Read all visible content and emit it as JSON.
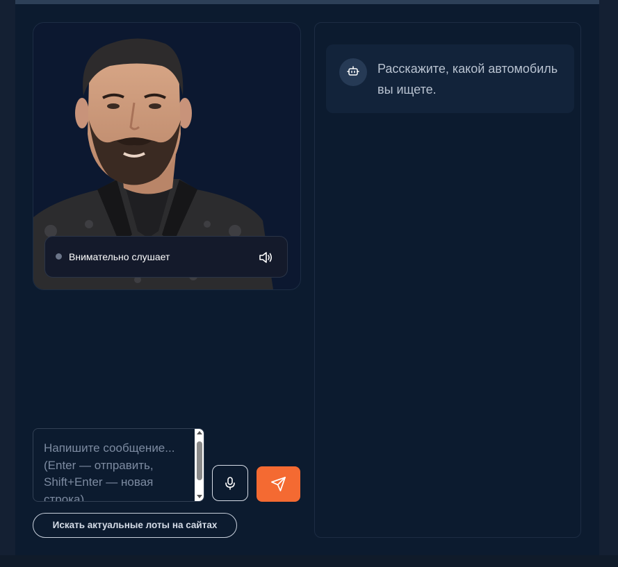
{
  "avatar": {
    "status_text": "Внимательно слушает",
    "icons": [
      "speaker-icon"
    ]
  },
  "composer": {
    "placeholder": "Напишите сообщение... (Enter — отправить, Shift+Enter — новая строка)",
    "mic_icon": "microphone-icon",
    "send_icon": "send-icon"
  },
  "search_lots_label": "Искать актуальные лоты на сайтах",
  "chat": {
    "bot_icon": "robot-icon",
    "message": "Расскажите, какой автомобиль вы ищете."
  },
  "colors": {
    "background": "#0c1b2f",
    "accent": "#f46a32",
    "bubble": "#12233a"
  }
}
